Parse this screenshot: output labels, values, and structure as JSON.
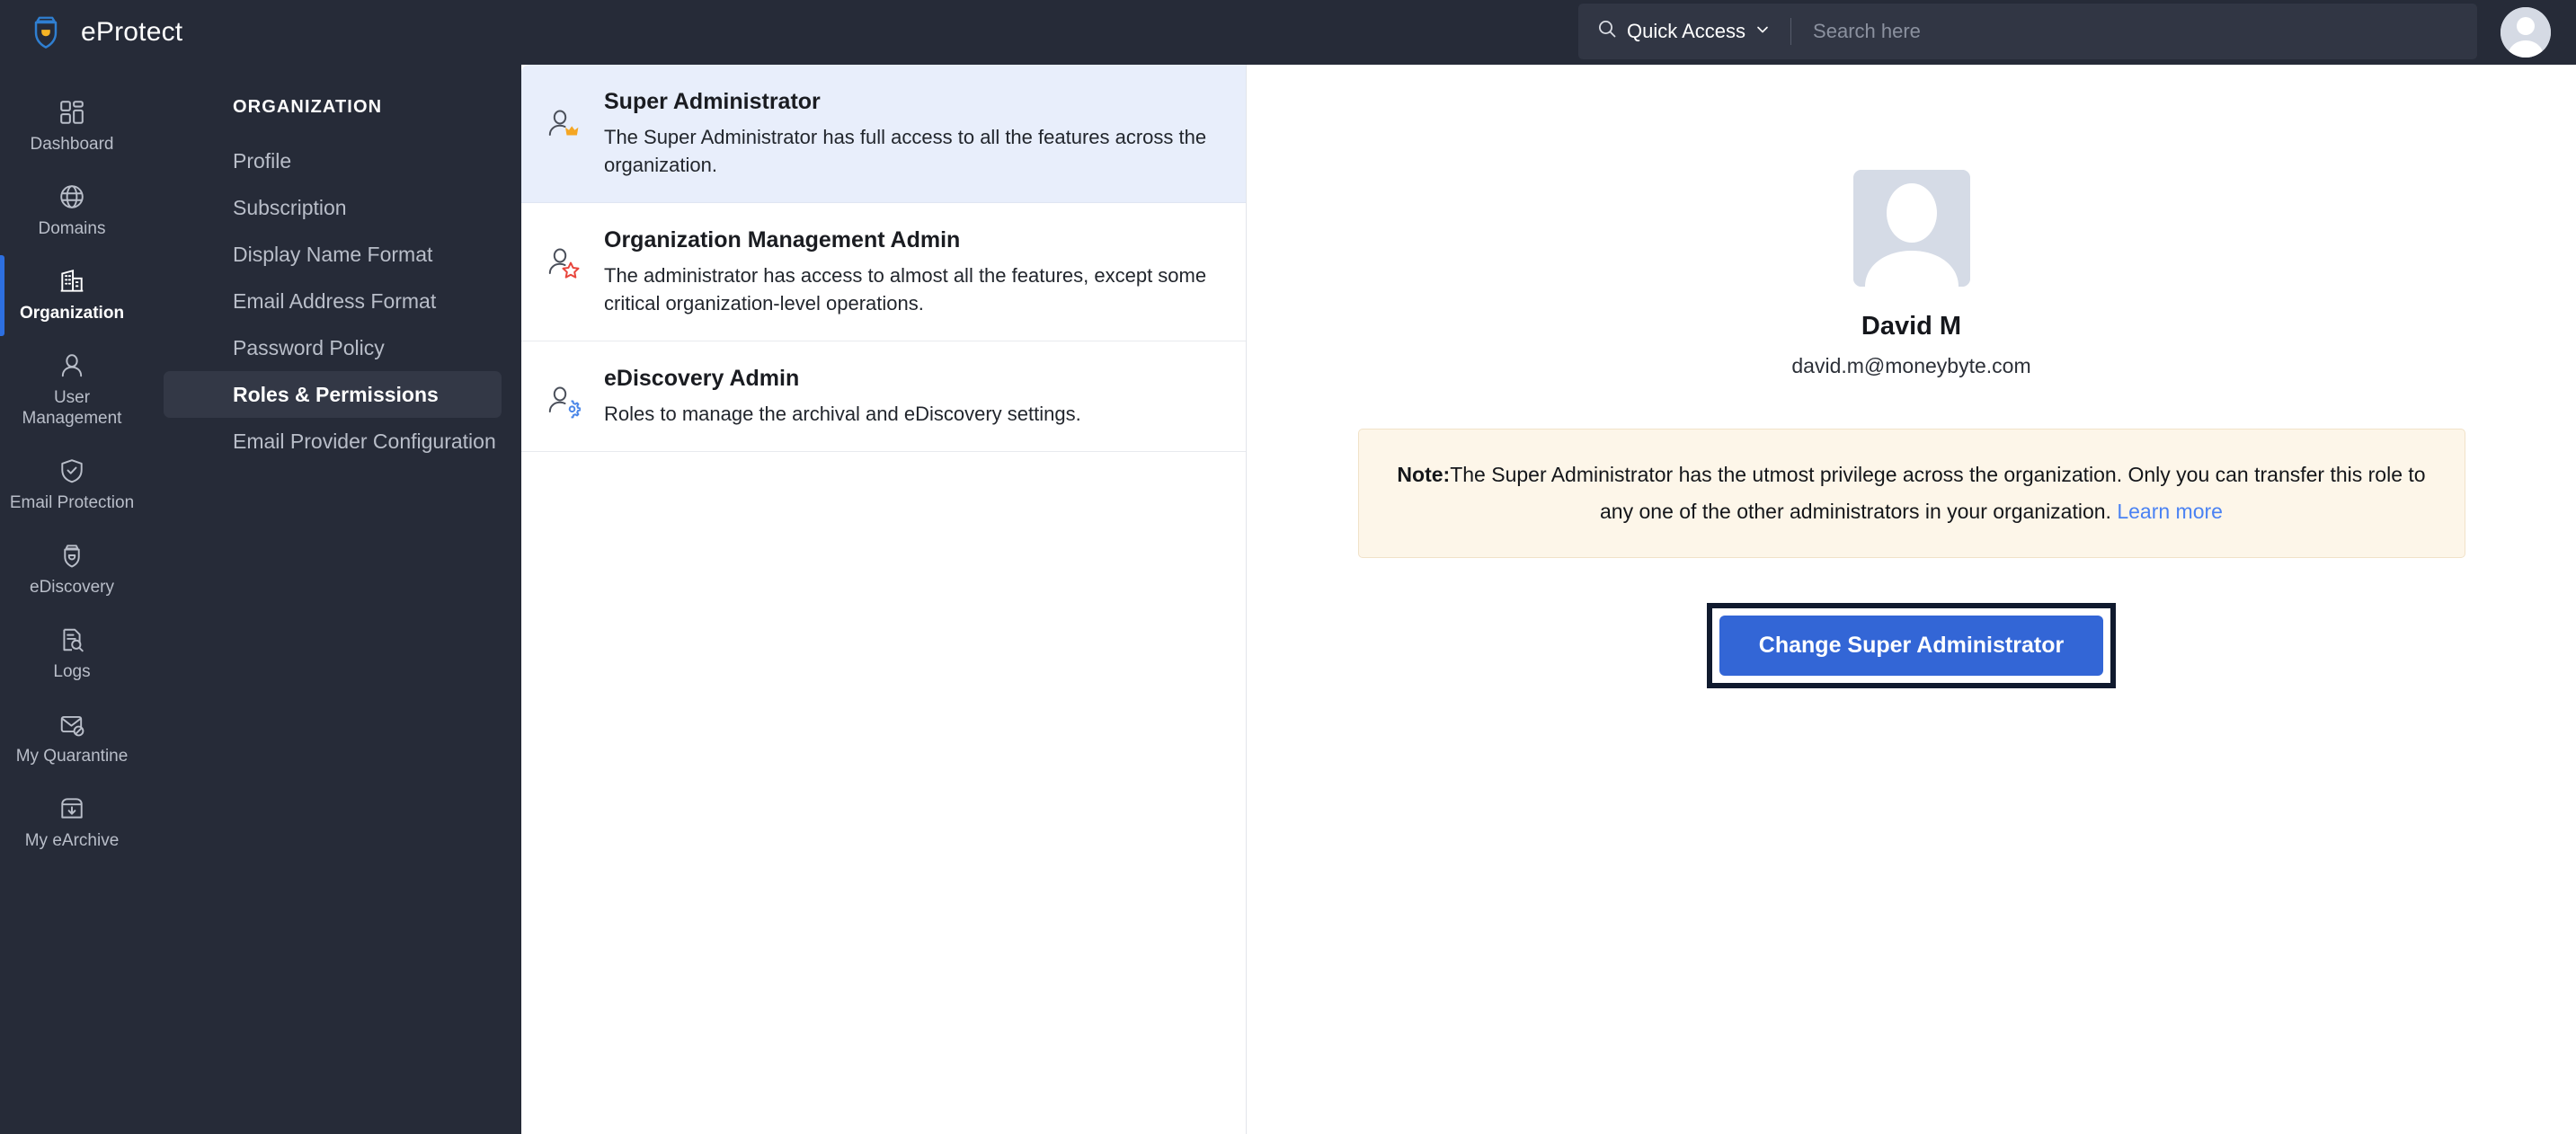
{
  "app": {
    "name": "eProtect",
    "logo_icon": "shield-logo-icon"
  },
  "topbar": {
    "quick_access_label": "Quick Access",
    "quick_access_icon": "search-icon",
    "chevron_icon": "chevron-down-icon",
    "search_placeholder": "Search here",
    "search_value": "",
    "avatar_icon": "user-avatar-icon"
  },
  "rail": {
    "items": [
      {
        "label": "Dashboard",
        "icon": "dashboard-grid-icon",
        "active": false
      },
      {
        "label": "Domains",
        "icon": "globe-icon",
        "active": false
      },
      {
        "label": "Organization",
        "icon": "building-icon",
        "active": true
      },
      {
        "label": "User Management",
        "icon": "user-icon",
        "active": false
      },
      {
        "label": "Email Protection",
        "icon": "shield-check-icon",
        "active": false
      },
      {
        "label": "eDiscovery",
        "icon": "shield-search-icon",
        "active": false
      },
      {
        "label": "Logs",
        "icon": "document-search-icon",
        "active": false
      },
      {
        "label": "My Quarantine",
        "icon": "mail-blocked-icon",
        "active": false
      },
      {
        "label": "My eArchive",
        "icon": "archive-download-icon",
        "active": false
      }
    ]
  },
  "subnav": {
    "title": "ORGANIZATION",
    "items": [
      {
        "label": "Profile",
        "active": false
      },
      {
        "label": "Subscription",
        "active": false
      },
      {
        "label": "Display Name Format",
        "active": false
      },
      {
        "label": "Email Address Format",
        "active": false
      },
      {
        "label": "Password Policy",
        "active": false
      },
      {
        "label": "Roles & Permissions",
        "active": true
      },
      {
        "label": "Email Provider Configuration",
        "active": false
      }
    ]
  },
  "roles": {
    "items": [
      {
        "name": "Super Administrator",
        "description": "The Super Administrator has full access to all the features across the organization.",
        "icon": "user-crown-icon",
        "selected": true
      },
      {
        "name": "Organization Management Admin",
        "description": "The administrator has access to almost all the features, except some critical organization-level operations.",
        "icon": "user-star-icon",
        "selected": false
      },
      {
        "name": "eDiscovery Admin",
        "description": "Roles to manage the archival and eDiscovery settings.",
        "icon": "user-gear-icon",
        "selected": false
      }
    ]
  },
  "detail": {
    "avatar_icon": "user-avatar-placeholder-icon",
    "name": "David M",
    "email": "david.m@moneybyte.com",
    "note": {
      "label": "Note:",
      "text": "The Super Administrator has the utmost privilege across the organization. Only you can transfer this role to any one of the other administrators in your organization.",
      "link_label": "Learn more"
    },
    "primary_button_label": "Change Super Administrator"
  },
  "colors": {
    "nav_bg": "#262b38",
    "accent_blue": "#2d6fe0",
    "button_blue": "#3366d6",
    "selected_row": "#e8eefb",
    "note_bg": "#fdf6e9",
    "link_blue": "#4a82f3",
    "crown_orange": "#f5a623",
    "star_red": "#e8453c",
    "gear_blue": "#4a86e8"
  }
}
